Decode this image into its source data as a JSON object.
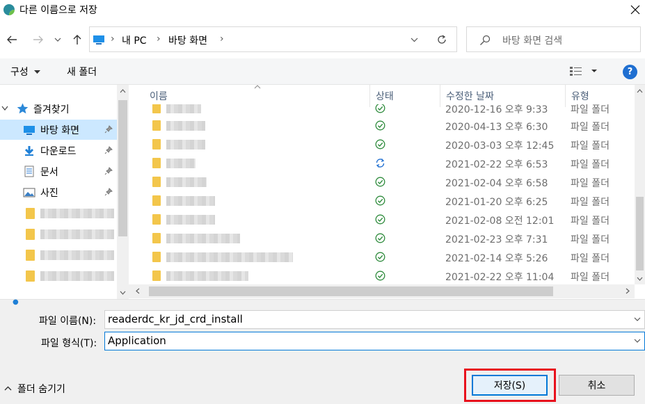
{
  "window": {
    "title": "다른 이름으로 저장",
    "accent": "#0078d7"
  },
  "address": {
    "path": [
      "내 PC",
      "바탕 화면"
    ]
  },
  "search": {
    "placeholder": "바탕 화면 검색"
  },
  "toolbar": {
    "organize_label": "구성",
    "new_folder_label": "새 폴더",
    "help_label": "?"
  },
  "nav": {
    "quick_access": "즐겨찾기",
    "items": [
      {
        "label": "바탕 화면",
        "icon": "desktop-icon",
        "pinned": true,
        "selected": true
      },
      {
        "label": "다운로드",
        "icon": "download-icon",
        "pinned": true
      },
      {
        "label": "문서",
        "icon": "document-icon",
        "pinned": true
      },
      {
        "label": "사진",
        "icon": "picture-icon",
        "pinned": true
      }
    ]
  },
  "columns": {
    "name": "이름",
    "status": "상태",
    "date": "수정한 날짜",
    "type": "유형"
  },
  "files": [
    {
      "status": "synced",
      "date": "2020-12-16 오후 9:33",
      "type": "파일 폴더"
    },
    {
      "status": "synced",
      "date": "2020-04-13 오후 6:30",
      "type": "파일 폴더"
    },
    {
      "status": "synced",
      "date": "2020-03-03 오후 12:45",
      "type": "파일 폴더"
    },
    {
      "status": "syncing",
      "date": "2021-02-22 오후 6:53",
      "type": "파일 폴더"
    },
    {
      "status": "synced",
      "date": "2021-02-04 오후 6:58",
      "type": "파일 폴더"
    },
    {
      "status": "synced",
      "date": "2021-01-20 오후 6:25",
      "type": "파일 폴더"
    },
    {
      "status": "synced",
      "date": "2021-02-08 오전 12:01",
      "type": "파일 폴더"
    },
    {
      "status": "synced",
      "date": "2021-02-23 오후 7:31",
      "type": "파일 폴더"
    },
    {
      "status": "synced",
      "date": "2021-02-14 오후 5:26",
      "type": "파일 폴더"
    },
    {
      "status": "synced",
      "date": "2021-02-22 오후 11:04",
      "type": "파일 폴더"
    }
  ],
  "form": {
    "filename_label": "파일 이름(N):",
    "filename_value": "readerdc_kr_jd_crd_install",
    "filetype_label": "파일 형식(T):",
    "filetype_value": "Application"
  },
  "buttons": {
    "save": "저장(S)",
    "cancel": "취소",
    "hide_folders": "폴더 숨기기"
  },
  "colors": {
    "synced": "#2e8b3c",
    "syncing": "#1f6fd1",
    "highlight": "#e8111c",
    "folder": "#f3c64b"
  }
}
